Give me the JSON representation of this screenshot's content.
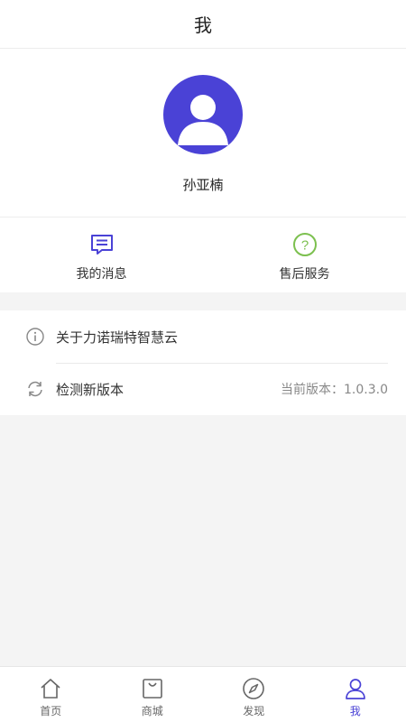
{
  "header": {
    "title": "我"
  },
  "profile": {
    "username": "孙亚楠",
    "avatar_icon": "user-avatar-icon",
    "avatar_color": "#4a42d6"
  },
  "quick_actions": [
    {
      "label": "我的消息",
      "icon": "message-icon",
      "color": "#4a42d6"
    },
    {
      "label": "售后服务",
      "icon": "help-circle-icon",
      "color": "#7cc04f"
    }
  ],
  "menu": {
    "about": {
      "label": "关于力诺瑞特智慧云",
      "icon": "info-icon"
    },
    "update": {
      "label": "检测新版本",
      "icon": "refresh-icon",
      "version_text": "当前版本：1.0.3.0"
    }
  },
  "tabbar": {
    "active_color": "#4a42d6",
    "tabs": [
      {
        "label": "首页",
        "icon": "home-icon"
      },
      {
        "label": "商城",
        "icon": "shopping-bag-icon"
      },
      {
        "label": "发现",
        "icon": "compass-icon"
      },
      {
        "label": "我",
        "icon": "person-icon",
        "active": true
      }
    ]
  }
}
